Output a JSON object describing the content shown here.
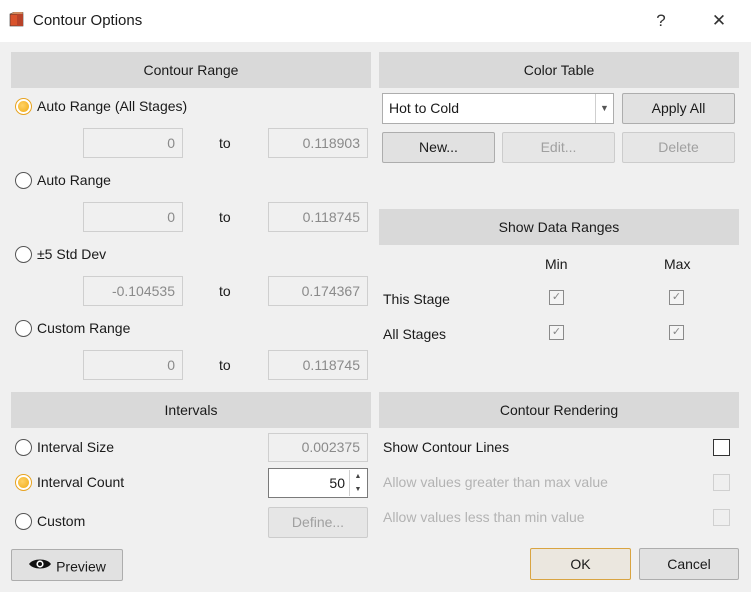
{
  "window": {
    "title": "Contour Options",
    "help_label": "?",
    "close_label": "✕"
  },
  "contour_range": {
    "header": "Contour Range",
    "to_label": "to",
    "options": [
      {
        "label": "Auto Range (All Stages)",
        "selected": true,
        "min": "0",
        "max": "0.118903"
      },
      {
        "label": "Auto Range",
        "selected": false,
        "min": "0",
        "max": "0.118745"
      },
      {
        "label": "±5 Std Dev",
        "selected": false,
        "min": "-0.104535",
        "max": "0.174367"
      },
      {
        "label": "Custom Range",
        "selected": false,
        "min": "0",
        "max": "0.118745"
      }
    ]
  },
  "color_table": {
    "header": "Color Table",
    "selected": "Hot to Cold",
    "apply_all": "Apply All",
    "new": "New...",
    "edit": "Edit...",
    "delete": "Delete"
  },
  "show_data_ranges": {
    "header": "Show Data Ranges",
    "col_min": "Min",
    "col_max": "Max",
    "rows": [
      {
        "label": "This Stage",
        "min": true,
        "max": true
      },
      {
        "label": "All Stages",
        "min": true,
        "max": true
      }
    ]
  },
  "intervals": {
    "header": "Intervals",
    "interval_size_label": "Interval Size",
    "interval_size_value": "0.002375",
    "interval_count_label": "Interval Count",
    "interval_count_value": "50",
    "custom_label": "Custom",
    "define_label": "Define...",
    "selected": "Interval Count"
  },
  "contour_rendering": {
    "header": "Contour Rendering",
    "show_lines_label": "Show Contour Lines",
    "show_lines_checked": false,
    "allow_greater_label": "Allow values greater than max value",
    "allow_less_label": "Allow values less than min value"
  },
  "footer": {
    "preview": "Preview",
    "ok": "OK",
    "cancel": "Cancel"
  },
  "colors": {
    "header_bg": "#d9d9d9",
    "radio_accent": "#f0ab16",
    "dialog_bg": "#f0f0f0"
  }
}
